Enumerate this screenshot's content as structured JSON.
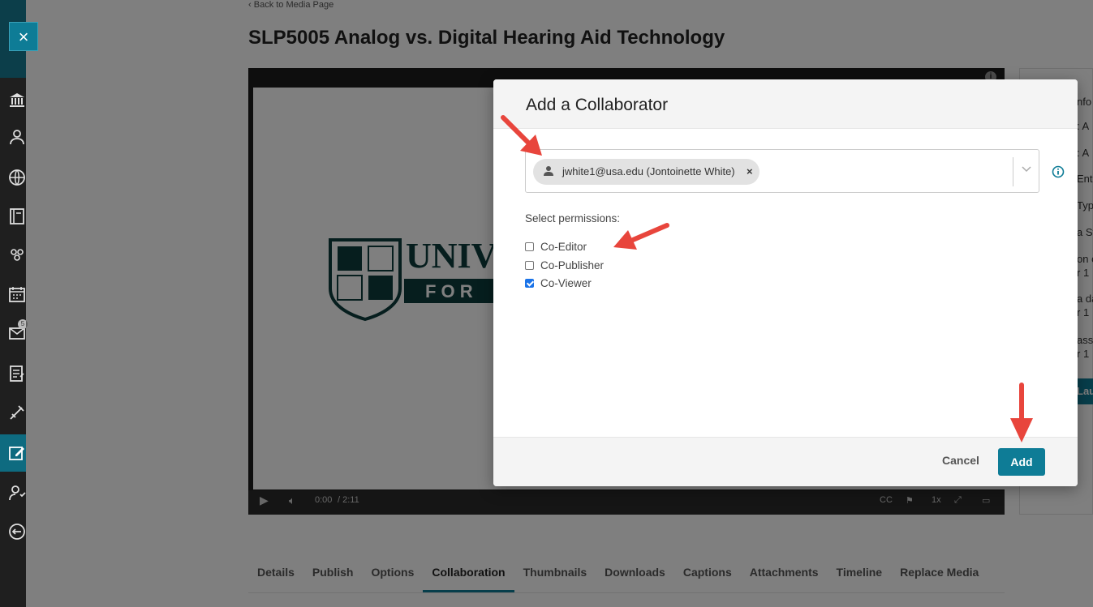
{
  "nav": {
    "close_label": "×",
    "items": [
      {
        "icon": "institution-icon"
      },
      {
        "icon": "user-icon"
      },
      {
        "icon": "globe-icon"
      },
      {
        "icon": "book-icon"
      },
      {
        "icon": "group-icon"
      },
      {
        "icon": "calendar-icon"
      },
      {
        "icon": "inbox-icon",
        "badge": "5"
      },
      {
        "icon": "grades-icon"
      },
      {
        "icon": "tools-icon"
      },
      {
        "icon": "edit-icon"
      },
      {
        "icon": "account-icon"
      },
      {
        "icon": "logout-icon"
      }
    ]
  },
  "page": {
    "back_link": "Back to Media Page",
    "title": "SLP5005 Analog vs. Digital Hearing Aid Technology"
  },
  "player": {
    "time_current": "0:00",
    "time_total": "/ 2:11",
    "speed": "1x",
    "logo_text": "UNIV",
    "logo_subtext": "F O R"
  },
  "right_panel": {
    "lines": [
      "nfo",
      ": A",
      ": A",
      "Ent",
      "Typ",
      "a St",
      "on c",
      "r 1",
      "a da",
      "r 1",
      "ass",
      "r 1"
    ],
    "button": "Lau"
  },
  "tabs": [
    "Details",
    "Publish",
    "Options",
    "Collaboration",
    "Thumbnails",
    "Downloads",
    "Captions",
    "Attachments",
    "Timeline",
    "Replace Media"
  ],
  "active_tab": "Collaboration",
  "modal": {
    "title": "Add a Collaborator",
    "selected_user": "jwhite1@usa.edu (Jontoinette White)",
    "remove_label": "×",
    "permissions_label": "Select permissions:",
    "permissions": [
      {
        "label": "Co-Editor",
        "checked": false
      },
      {
        "label": "Co-Publisher",
        "checked": false
      },
      {
        "label": "Co-Viewer",
        "checked": true
      }
    ],
    "cancel_label": "Cancel",
    "add_label": "Add"
  },
  "colors": {
    "accent": "#0e7c96",
    "arrow": "#e8453c"
  }
}
